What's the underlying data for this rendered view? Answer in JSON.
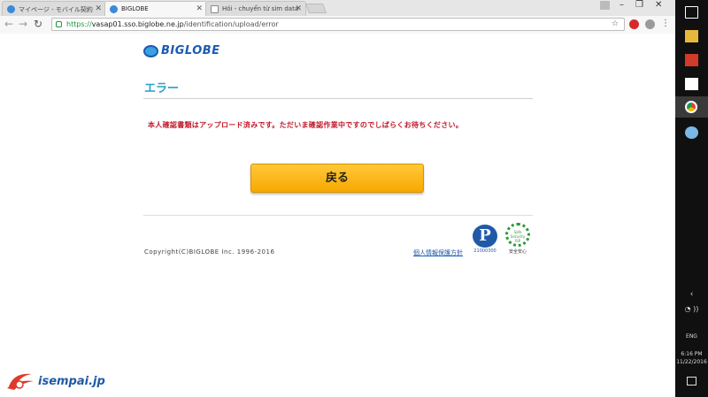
{
  "browser": {
    "tabs": [
      {
        "label": "マイページ - モバイル契約"
      },
      {
        "label": "BIGLOBE"
      },
      {
        "label": "Hỏi - chuyển từ sim data"
      }
    ],
    "url_scheme": "https://",
    "url_host": "vasap01.sso.biglobe.ne.jp",
    "url_path": "/identification/upload/error"
  },
  "page": {
    "logo_text": "BIGLOBE",
    "heading": "エラー",
    "error_message": "本人確認書類はアップロード済みです。ただいま確認作業中ですのでしばらくお待ちください。",
    "back_button": "戻る",
    "copyright": "Copyright(C)BIGLOBE Inc. 1996-2016",
    "privacy_link": "個人情報保護方針",
    "pmark_number": "21000300",
    "isp_badge_text": "Safe Security ISP",
    "isp_badge_label": "安全安心"
  },
  "taskbar": {
    "language": "ENG",
    "time": "6:16 PM",
    "date": "11/22/2016"
  },
  "watermark": {
    "text": "isempai.jp"
  },
  "colors": {
    "heading": "#2aa0c8",
    "error": "#c0182a",
    "button": "#f7a800",
    "brand": "#1b5bb0"
  }
}
